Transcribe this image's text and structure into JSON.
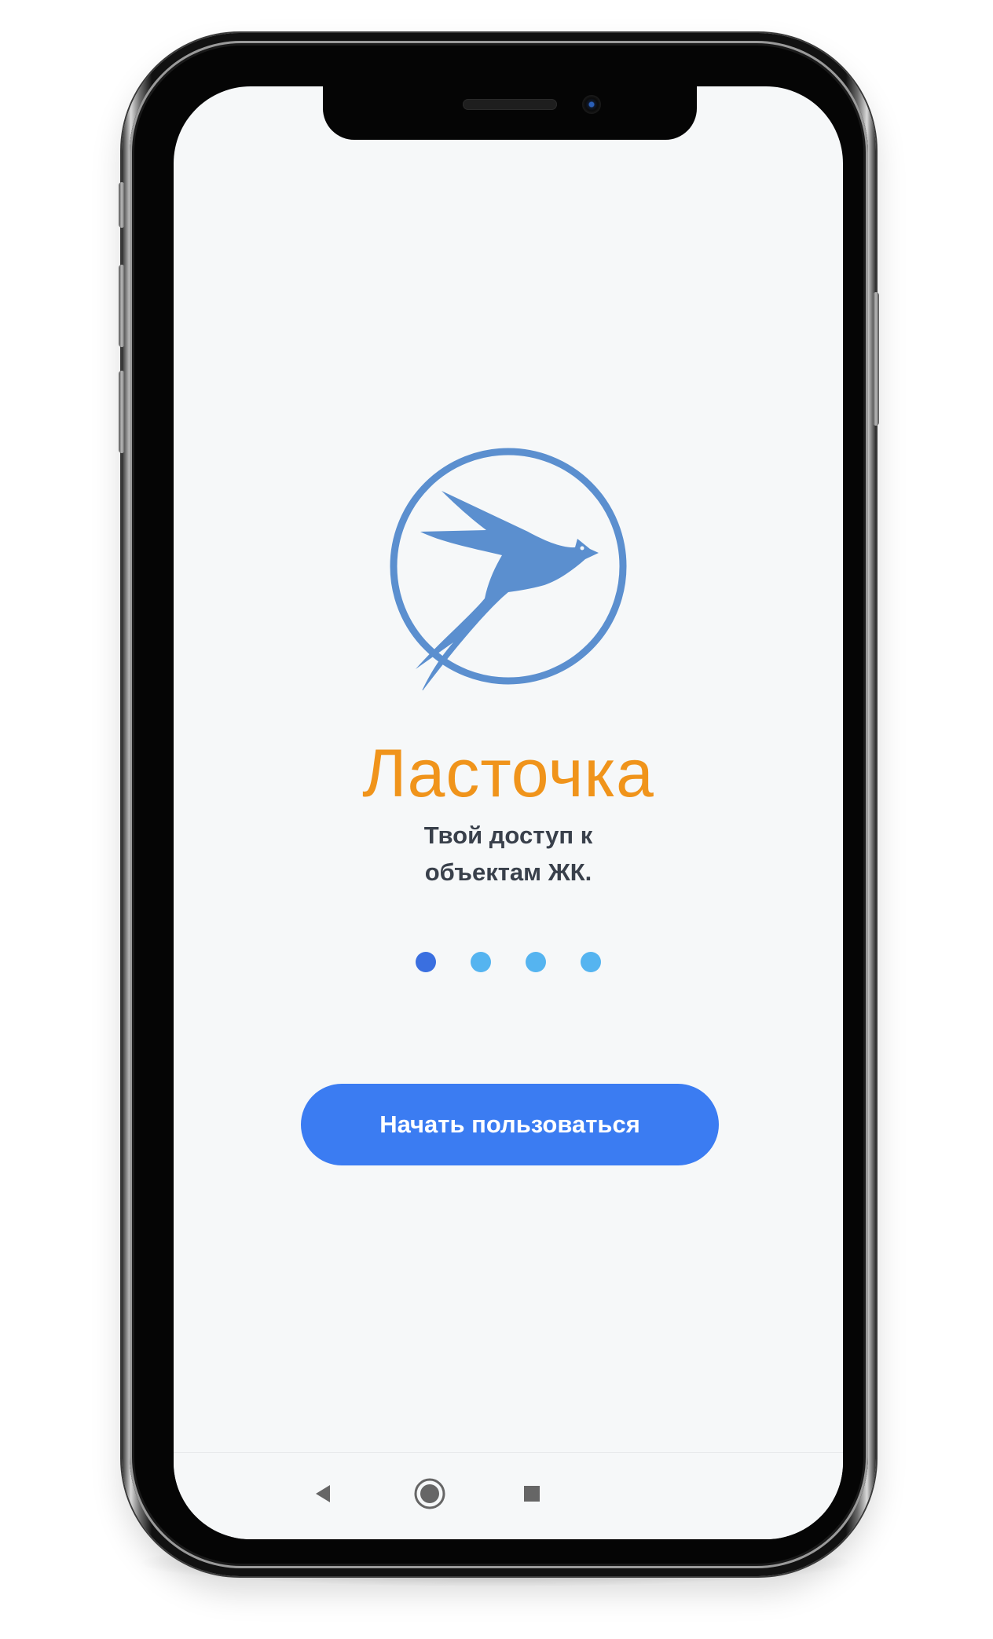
{
  "app": {
    "brand_name": "Ласточка",
    "tagline_line1": "Твой доступ к",
    "tagline_line2": "объектам ЖК.",
    "logo_icon": "swallow-in-circle-icon"
  },
  "onboarding": {
    "page_count": 4,
    "active_index": 0,
    "dot_colors": {
      "active": "#3a6fe0",
      "inactive": "#55b4f0"
    }
  },
  "cta": {
    "label": "Начать пользоваться"
  },
  "system_nav": {
    "back_icon": "back-triangle-icon",
    "home_icon": "home-circle-icon",
    "recents_icon": "recents-square-icon"
  },
  "colors": {
    "brand_orange": "#f0941b",
    "logo_blue": "#5b8fcf",
    "button_blue": "#3b7cf2",
    "screen_bg": "#f6f8f9",
    "text_dark": "#39404b"
  }
}
